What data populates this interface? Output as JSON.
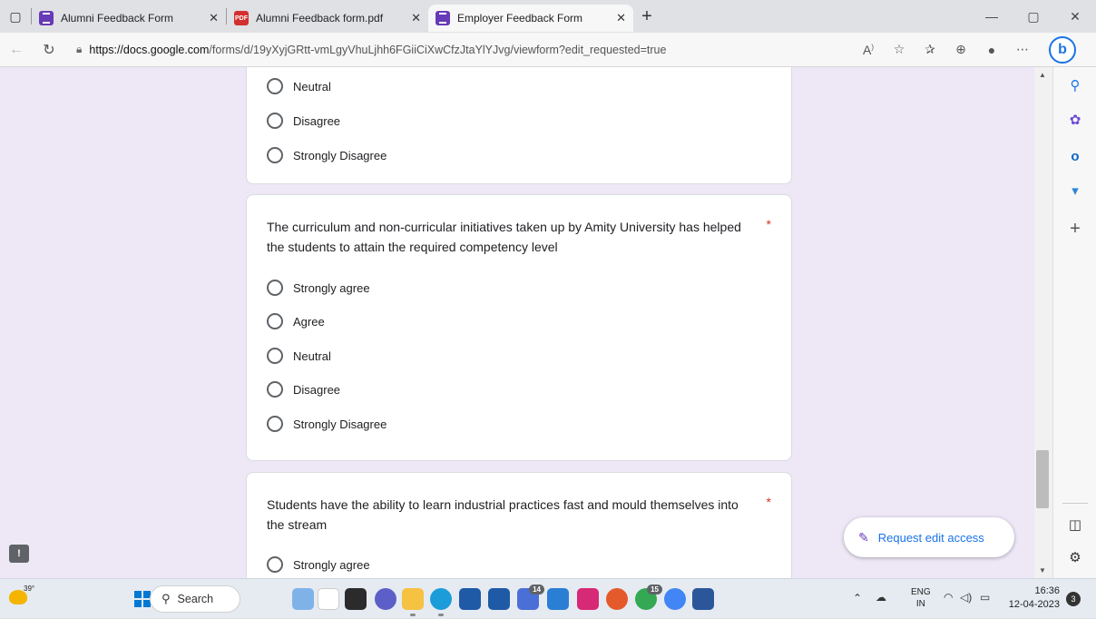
{
  "browser": {
    "tabs": [
      {
        "title": "Alumni Feedback Form",
        "icon": "forms-icon",
        "active": false
      },
      {
        "title": "Alumni Feedback form.pdf",
        "icon": "pdf-icon",
        "active": false
      },
      {
        "title": "Employer Feedback Form",
        "icon": "forms-icon",
        "active": true
      }
    ],
    "url_host": "https://docs.google.com",
    "url_path": "/forms/d/19yXyjGRtt-vmLgyVhuLjhh6FGiiCiXwCfzJtaYlYJvg/viewform?edit_requested=true"
  },
  "form": {
    "card1": {
      "options": [
        "Neutral",
        "Disagree",
        "Strongly Disagree"
      ]
    },
    "card2": {
      "question": "The curriculum and non-curricular initiatives taken up by Amity University has helped the students to attain the required competency level",
      "required_mark": "*",
      "options": [
        "Strongly agree",
        "Agree",
        "Neutral",
        "Disagree",
        "Strongly Disagree"
      ]
    },
    "card3": {
      "question": "Students have the ability to learn industrial practices fast and mould themselves into the stream",
      "required_mark": "*",
      "options": [
        "Strongly agree"
      ]
    },
    "edit_access_label": "Request edit access",
    "feedback_label": "!"
  },
  "taskbar": {
    "temperature": "39°",
    "search_label": "Search",
    "badges": {
      "app_14": "14",
      "app_15": "15"
    },
    "lang_line1": "ENG",
    "lang_line2": "IN",
    "time": "16:36",
    "date": "12-04-2023",
    "notification_count": "3"
  },
  "colors": {
    "form_background": "#ede7f6",
    "accent": "#673ab7",
    "required": "#d93025",
    "link": "#1a73e8"
  }
}
